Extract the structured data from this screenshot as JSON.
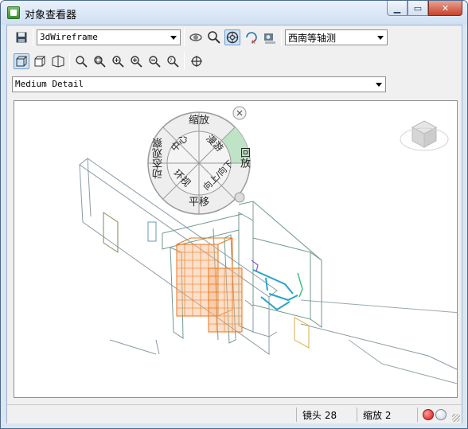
{
  "window": {
    "title": "对象查看器"
  },
  "toolbar1": {
    "visual_style": "3dWireframe",
    "view": "西南等轴测",
    "icons": [
      "save-icon",
      "orbit-icon",
      "zoom-icon",
      "steering-wheel-icon",
      "rotate-x-icon",
      "camera-icon"
    ]
  },
  "toolbar2": {
    "icons": [
      "view-cube-icon",
      "box-view-icon",
      "perspective-icon",
      "zoom-realtime-icon",
      "zoom-window-icon",
      "zoom-extents-icon",
      "zoom-in-icon",
      "zoom-out-icon",
      "zoom-previous-icon",
      "pan-icon"
    ]
  },
  "detail": {
    "level": "Medium Detail"
  },
  "steering_wheel": {
    "zoom": "缩放",
    "center": "中心",
    "walk": "漫游",
    "rewind": "回放",
    "orbit": "动态观察",
    "look": "环视",
    "up_down": "向上/向下",
    "pan": "平移"
  },
  "status": {
    "lens": "镜头 28",
    "zoom": "缩放 2"
  },
  "colors": {
    "accent": "#e8761e",
    "cyan": "#2aa3c7",
    "wire": "#7f9aa8"
  }
}
